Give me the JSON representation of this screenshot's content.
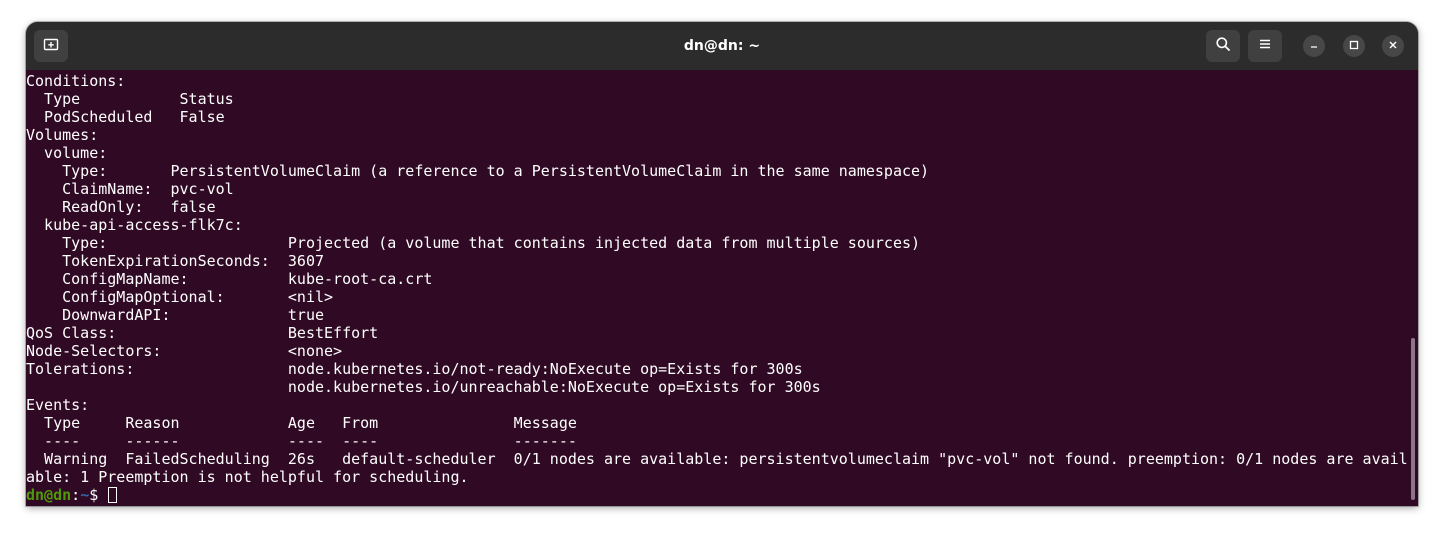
{
  "window": {
    "title": "dn@dn: ~"
  },
  "icons": {
    "new_tab": "new-tab-icon",
    "search": "search-icon",
    "menu": "hamburger-menu-icon",
    "minimize": "minimize-icon",
    "maximize": "maximize-icon",
    "close": "close-icon"
  },
  "colors": {
    "terminal_bg": "#300a24",
    "titlebar_bg": "#2c2c2c",
    "text": "#ffffff",
    "prompt_user": "#4e9a06",
    "prompt_path": "#3465a4"
  },
  "terminal": {
    "lines": [
      "Conditions:",
      "  Type           Status",
      "  PodScheduled   False",
      "Volumes:",
      "  volume:",
      "    Type:       PersistentVolumeClaim (a reference to a PersistentVolumeClaim in the same namespace)",
      "    ClaimName:  pvc-vol",
      "    ReadOnly:   false",
      "  kube-api-access-flk7c:",
      "    Type:                    Projected (a volume that contains injected data from multiple sources)",
      "    TokenExpirationSeconds:  3607",
      "    ConfigMapName:           kube-root-ca.crt",
      "    ConfigMapOptional:       <nil>",
      "    DownwardAPI:             true",
      "QoS Class:                   BestEffort",
      "Node-Selectors:              <none>",
      "Tolerations:                 node.kubernetes.io/not-ready:NoExecute op=Exists for 300s",
      "                             node.kubernetes.io/unreachable:NoExecute op=Exists for 300s",
      "Events:",
      "  Type     Reason            Age   From               Message",
      "  ----     ------            ----  ----               -------",
      "  Warning  FailedScheduling  26s   default-scheduler  0/1 nodes are available: persistentvolumeclaim \"pvc-vol\" not found. preemption: 0/1 nodes are avail",
      "able: 1 Preemption is not helpful for scheduling."
    ],
    "prompt": {
      "user": "dn@dn",
      "separator": ":",
      "path": "~",
      "symbol": "$ "
    }
  }
}
